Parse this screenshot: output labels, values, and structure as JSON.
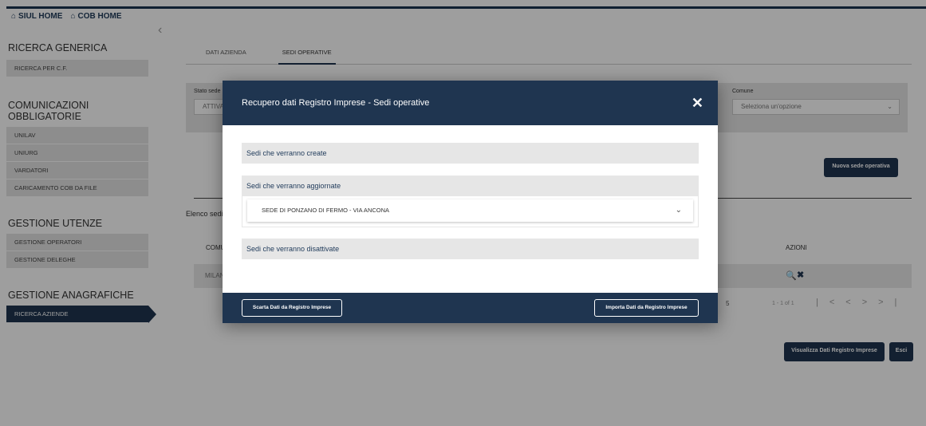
{
  "topnav": {
    "home1": "SIUL HOME",
    "home2": "COB HOME"
  },
  "sidebar": {
    "sections": [
      {
        "title": "RICERCA GENERICA",
        "items": [
          "RICERCA PER C.F."
        ]
      },
      {
        "title": "COMUNICAZIONI OBBLIGATORIE",
        "items": [
          "UNILAV",
          "UNIURG",
          "VARDATORI",
          "CARICAMENTO COB DA FILE"
        ]
      },
      {
        "title": "GESTIONE UTENZE",
        "items": [
          "GESTIONE OPERATORI",
          "GESTIONE DELEGHE"
        ]
      },
      {
        "title": "GESTIONE ANAGRAFICHE",
        "items": [
          "RICERCA AZIENDE"
        ]
      }
    ]
  },
  "tabs": [
    "DATI AZIENDA",
    "SEDI OPERATIVE"
  ],
  "filter": {
    "stato_label": "Stato sede",
    "stato_value": "ATTIVA",
    "comune_label": "Comune",
    "comune_placeholder": "Seleziona un'opzione"
  },
  "main": {
    "new_button": "Nuova sede operativa",
    "list_title": "Elenco sedi",
    "col_comune": "COMUNE",
    "col_azioni": "AZIONI",
    "row_comune": "MILANO",
    "pager_size": "5",
    "pager_range": "1 - 1 of 1",
    "btn_visualizza": "Visualizza Dati Registro Imprese",
    "btn_esci": "Esci"
  },
  "modal": {
    "title": "Recupero dati Registro Imprese - Sedi operative",
    "panel_create": "Sedi che verranno create",
    "panel_update": "Sedi che verranno aggiornate",
    "update_item": "SEDE DI PONZANO DI FERMO - VIA ANCONA",
    "panel_disable": "Sedi che verranno disattivate",
    "btn_scarta": "Scarta Dati da Registro Imprese",
    "btn_importa": "Importa Dati da Registro Imprese"
  }
}
